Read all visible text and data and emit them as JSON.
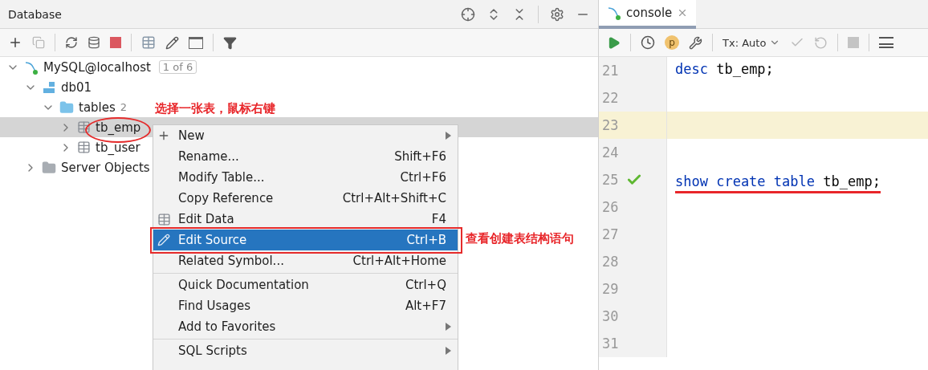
{
  "database_panel": {
    "title": "Database",
    "tree": [
      {
        "label": "MySQL@localhost",
        "badge": "1 of 6",
        "kind": "datasource",
        "expanded": true,
        "selected": false,
        "children": [
          {
            "label": "db01",
            "kind": "schema",
            "expanded": true,
            "selected": false,
            "children": [
              {
                "label": "tables",
                "count": "2",
                "kind": "folder",
                "expanded": true,
                "selected": false,
                "children": [
                  {
                    "label": "tb_emp",
                    "kind": "table",
                    "expanded": false,
                    "selected": true,
                    "circled": true
                  },
                  {
                    "label": "tb_user",
                    "kind": "table",
                    "expanded": false,
                    "selected": false,
                    "circled": false
                  }
                ]
              }
            ]
          },
          {
            "label": "Server Objects",
            "kind": "server",
            "expanded": false,
            "selected": false
          }
        ]
      }
    ],
    "tree_note": "选择一张表，鼠标右键"
  },
  "context_menu": {
    "items": [
      {
        "kind": "add",
        "label": "New",
        "submenu": true,
        "selected": false
      },
      {
        "kind": "plain",
        "label": "Rename...",
        "shortcut": "Shift+F6",
        "submenu": false,
        "selected": false
      },
      {
        "kind": "plain",
        "label": "Modify Table...",
        "shortcut": "Ctrl+F6",
        "submenu": false,
        "selected": false
      },
      {
        "kind": "plain",
        "label": "Copy Reference",
        "shortcut": "Ctrl+Alt+Shift+C",
        "submenu": false,
        "selected": false
      },
      {
        "kind": "grid",
        "label": "Edit Data",
        "shortcut": "F4",
        "submenu": false,
        "selected": false
      },
      {
        "kind": "edit",
        "label": "Edit Source",
        "shortcut": "Ctrl+B",
        "submenu": false,
        "selected": true,
        "boxed": true
      },
      {
        "kind": "plain",
        "label": "Related Symbol...",
        "shortcut": "Ctrl+Alt+Home",
        "submenu": false,
        "selected": false
      },
      {
        "kind": "separator"
      },
      {
        "kind": "plain",
        "label": "Quick Documentation",
        "shortcut": "Ctrl+Q",
        "submenu": false,
        "selected": false
      },
      {
        "kind": "plain",
        "label": "Find Usages",
        "shortcut": "Alt+F7",
        "submenu": false,
        "selected": false
      },
      {
        "kind": "plain",
        "label": "Add to Favorites",
        "submenu": true,
        "selected": false
      },
      {
        "kind": "separator"
      },
      {
        "kind": "plain",
        "label": "SQL Scripts",
        "submenu": true,
        "selected": false
      }
    ],
    "note": "查看创建表结构语句"
  },
  "console": {
    "tab": "console",
    "tx_mode": "Tx: Auto",
    "params_badge": "p",
    "lines": [
      {
        "number": "21",
        "current": false,
        "executed": false,
        "underlined": false,
        "tokens": [
          {
            "kind": "keyword",
            "text": "desc"
          },
          {
            "kind": "plain",
            "text": " tb_emp;"
          }
        ]
      },
      {
        "number": "22",
        "current": false,
        "executed": false
      },
      {
        "number": "23",
        "current": true,
        "executed": false
      },
      {
        "number": "24",
        "current": false,
        "executed": false
      },
      {
        "number": "25",
        "current": false,
        "executed": true,
        "underlined": true,
        "tokens": [
          {
            "kind": "keyword",
            "text": "show create table"
          },
          {
            "kind": "plain",
            "text": " tb_emp;"
          }
        ]
      },
      {
        "number": "26",
        "current": false,
        "executed": false
      },
      {
        "number": "27",
        "current": false,
        "executed": false
      },
      {
        "number": "28",
        "current": false,
        "executed": false
      },
      {
        "number": "29",
        "current": false,
        "executed": false
      },
      {
        "number": "30",
        "current": false,
        "executed": false
      },
      {
        "number": "31",
        "current": false,
        "executed": false
      }
    ]
  }
}
